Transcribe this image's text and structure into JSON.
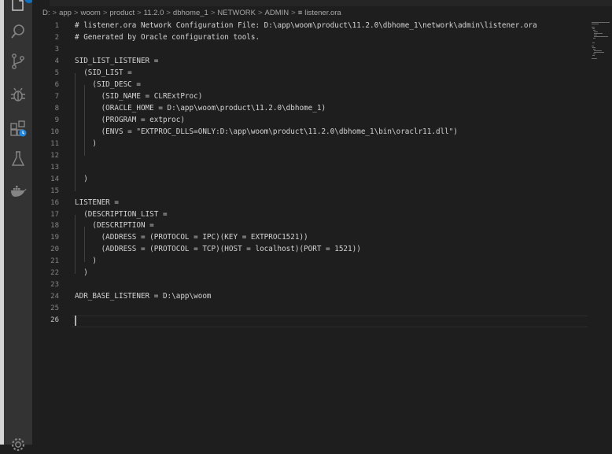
{
  "activity_bar": {
    "icons": [
      "explorer-icon",
      "search-icon",
      "source-control-icon",
      "debug-icon",
      "extensions-icon",
      "testing-icon",
      "docker-icon",
      "settings-gear-icon"
    ],
    "explorer_badge": "1"
  },
  "breadcrumb": {
    "segments": [
      "D:",
      "app",
      "woom",
      "product",
      "11.2.0",
      "dbhome_1",
      "NETWORK",
      "ADMIN"
    ],
    "separator": ">",
    "file_icon": "≡",
    "file": "listener.ora"
  },
  "editor": {
    "line_numbers": [
      "1",
      "2",
      "3",
      "4",
      "5",
      "6",
      "7",
      "8",
      "9",
      "10",
      "11",
      "12",
      "13",
      "14",
      "15",
      "16",
      "17",
      "18",
      "19",
      "20",
      "21",
      "22",
      "23",
      "24",
      "25",
      "26"
    ],
    "active_line": 26,
    "lines": [
      "# listener.ora Network Configuration File: D:\\app\\woom\\product\\11.2.0\\dbhome_1\\network\\admin\\listener.ora",
      "# Generated by Oracle configuration tools.",
      "",
      "SID_LIST_LISTENER =",
      "  (SID_LIST =",
      "    (SID_DESC =",
      "      (SID_NAME = CLRExtProc)",
      "      (ORACLE_HOME = D:\\app\\woom\\product\\11.2.0\\dbhome_1)",
      "      (PROGRAM = extproc)",
      "      (ENVS = \"EXTPROC_DLLS=ONLY:D:\\app\\woom\\product\\11.2.0\\dbhome_1\\bin\\oraclr11.dll\")",
      "    )",
      "",
      "",
      "  )",
      "",
      "LISTENER =",
      "  (DESCRIPTION_LIST =",
      "    (DESCRIPTION =",
      "      (ADDRESS = (PROTOCOL = IPC)(KEY = EXTPROC1521))",
      "      (ADDRESS = (PROTOCOL = TCP)(HOST = localhost)(PORT = 1521))",
      "    )",
      "  )",
      "",
      "ADR_BASE_LISTENER = D:\\app\\woom",
      "",
      ""
    ]
  },
  "colors": {
    "editor_bg": "#1e1e1e",
    "activity_bg": "#333333",
    "badge": "#0e70c0",
    "text": "#d4d4d4",
    "line_number": "#858585"
  }
}
